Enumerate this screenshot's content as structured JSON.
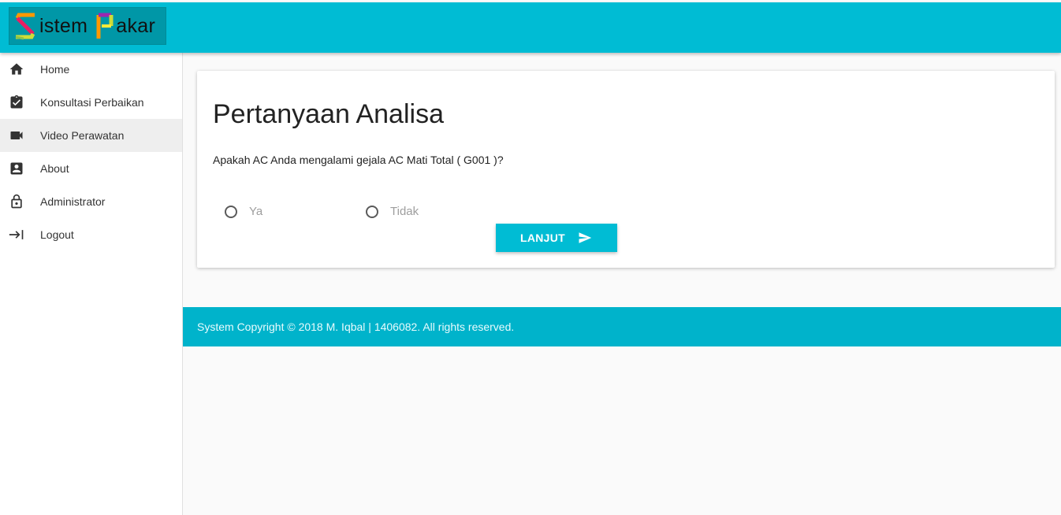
{
  "header": {
    "logo_text_1": "istem",
    "logo_text_2": "akar",
    "logo_full": "Sistem Pakar",
    "accent_color": "#00bcd4"
  },
  "sidebar": {
    "items": [
      {
        "label": "Home",
        "icon": "home-icon"
      },
      {
        "label": "Konsultasi Perbaikan",
        "icon": "clipboard-check-icon"
      },
      {
        "label": "Video Perawatan",
        "icon": "video-camera-icon",
        "active": true
      },
      {
        "label": "About",
        "icon": "account-box-icon"
      },
      {
        "label": "Administrator",
        "icon": "lock-icon"
      },
      {
        "label": "Logout",
        "icon": "logout-arrow-icon"
      }
    ]
  },
  "main": {
    "title": "Pertanyaan Analisa",
    "question": "Apakah AC Anda mengalami gejala AC Mati Total ( G001 )?",
    "options": [
      "Ya",
      "Tidak"
    ],
    "submit_label": "LANJUT",
    "submit_icon": "send-icon"
  },
  "footer": {
    "text": "System Copyright © 2018 M. Iqbal | 1406082. All rights reserved."
  }
}
